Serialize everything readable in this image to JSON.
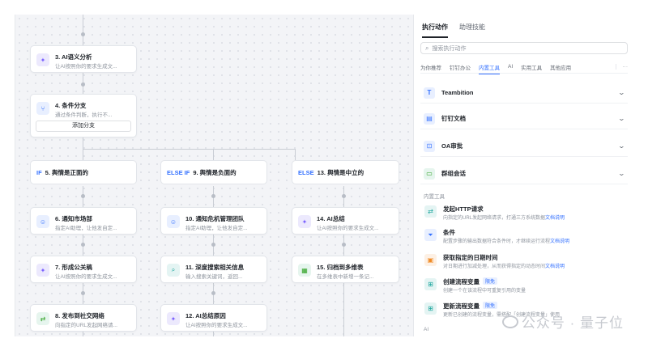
{
  "canvas": {
    "nodes": [
      {
        "id": "n3",
        "title": "3. AI语义分析",
        "subtitle": "让AI按照你的要求生成文...",
        "icon": "ai-sparkle-icon"
      },
      {
        "id": "n4",
        "title": "4. 条件分支",
        "subtitle": "通过条件判断，执行不...",
        "icon": "branch-icon",
        "button": "添加分支"
      },
      {
        "id": "n6",
        "title": "6. 通知市场部",
        "subtitle": "指定AI助理，让他发自定...",
        "icon": "bot-message-icon"
      },
      {
        "id": "n7",
        "title": "7. 形成公关稿",
        "subtitle": "让AI按照你的要求生成文...",
        "icon": "ai-sparkle-icon"
      },
      {
        "id": "n8",
        "title": "8. 发布到社交网络",
        "subtitle": "向指定的URL发起网络请...",
        "icon": "http-icon"
      },
      {
        "id": "n10",
        "title": "10. 通知危机管理团队",
        "subtitle": "指定AI助理，让他发自定...",
        "icon": "bot-message-icon"
      },
      {
        "id": "n11",
        "title": "11. 深度搜索相关信息",
        "subtitle": "输入搜索关键词，返回...",
        "icon": "search-icon"
      },
      {
        "id": "n12",
        "title": "12. AI总结原因",
        "subtitle": "让AI按照你的要求生成文...",
        "icon": "ai-sparkle-icon"
      },
      {
        "id": "n14",
        "title": "14. AI总结",
        "subtitle": "让AI按照你的要求生成文...",
        "icon": "ai-sparkle-icon"
      },
      {
        "id": "n15",
        "title": "15. 归档到多维表",
        "subtitle": "在多维表中新增一条记...",
        "icon": "table-icon"
      }
    ],
    "conditions": [
      {
        "keyword": "IF",
        "label": "5. 舆情是正面的"
      },
      {
        "keyword": "ELSE IF",
        "label": "9. 舆情是负面的"
      },
      {
        "keyword": "ELSE",
        "label": "13. 舆情是中立的"
      }
    ]
  },
  "panel": {
    "tabs": [
      "执行动作",
      "助理技能"
    ],
    "search_placeholder": "搜索执行动作",
    "categories": [
      "为你推荐",
      "钉钉办公",
      "内置工具",
      "AI",
      "实用工具",
      "其他应用"
    ],
    "more": "···",
    "groups": [
      {
        "name": "Teambition",
        "icon": "teambition-icon",
        "color": "#3370ff"
      },
      {
        "name": "钉钉文档",
        "icon": "doc-icon",
        "color": "#3370ff"
      },
      {
        "name": "OA审批",
        "icon": "approval-icon",
        "color": "#3370ff"
      },
      {
        "name": "群组会话",
        "icon": "chat-icon",
        "color": "#2ea121"
      }
    ],
    "section_builtin": "内置工具",
    "tools": [
      {
        "name": "发起HTTP请求",
        "desc": "向指定的URL发起网络请求，打通三方系统数据",
        "link": "文档说明",
        "icon": "http-icon",
        "badge": ""
      },
      {
        "name": "条件",
        "desc": "配置步骤的输出数据符合条件时，才继续运行流程",
        "link": "文档说明",
        "icon": "filter-icon",
        "badge": ""
      },
      {
        "name": "获取指定的日期时间",
        "desc": "对日期进行加减处理，从而获得指定的动态时间",
        "link": "文档说明",
        "icon": "calendar-icon",
        "badge": ""
      },
      {
        "name": "创建流程变量",
        "desc": "创建一个在该流程中可重复引用的变量",
        "link": "",
        "icon": "variable-icon",
        "badge": "限免"
      },
      {
        "name": "更新流程变量",
        "desc": "更新已创建的流程变量，需搭配「创建流程变量」使用",
        "link": "",
        "icon": "variable-icon",
        "badge": "限免"
      }
    ],
    "section_ai": "AI"
  },
  "watermark": "公众号 · 量子位"
}
